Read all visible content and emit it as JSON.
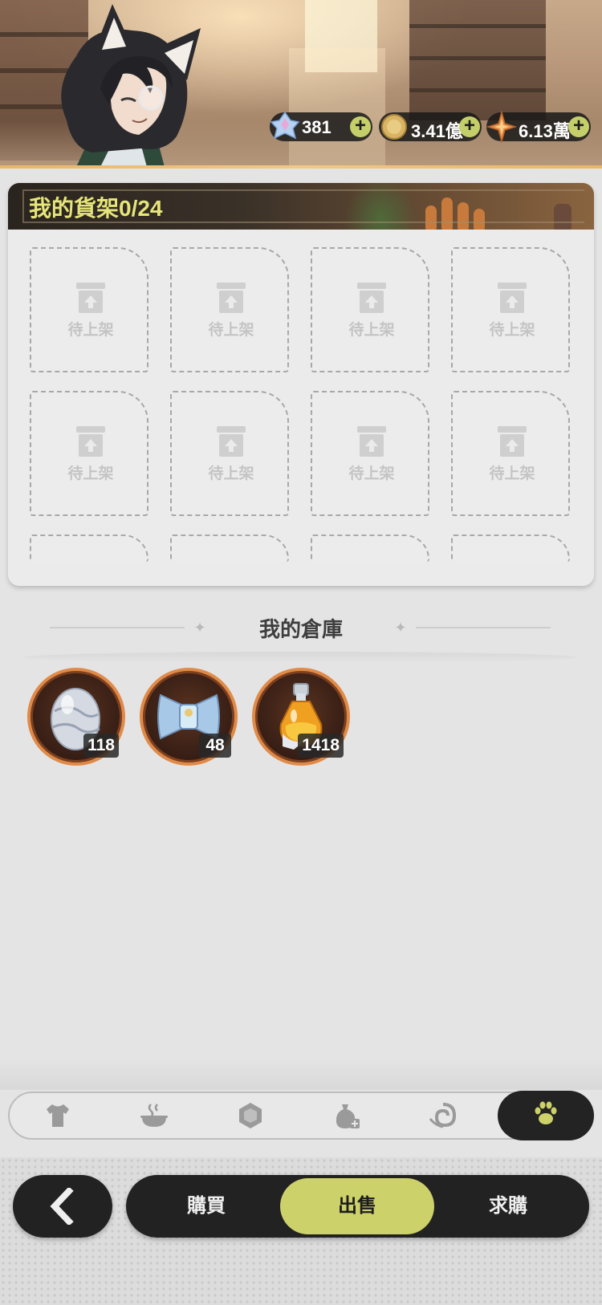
{
  "header": {
    "currencies": [
      {
        "name": "crystal",
        "icon": "crystal-gem-icon",
        "value": "381"
      },
      {
        "name": "gold-coin",
        "icon": "gold-coin-icon",
        "value": "3.41億"
      },
      {
        "name": "star-shard",
        "icon": "star-shard-icon",
        "value": "6.13萬"
      }
    ],
    "plus_label": "+"
  },
  "shelf": {
    "title": "我的貨架0/24",
    "slot_label": "待上架",
    "slots": [
      "待上架",
      "待上架",
      "待上架",
      "待上架",
      "待上架",
      "待上架",
      "待上架",
      "待上架"
    ]
  },
  "warehouse": {
    "title": "我的倉庫",
    "items": [
      {
        "name": "egg",
        "icon": "egg-icon",
        "qty": "118"
      },
      {
        "name": "bandage-scroll",
        "icon": "bandage-icon",
        "qty": "48"
      },
      {
        "name": "potion",
        "icon": "potion-icon",
        "qty": "1418"
      }
    ]
  },
  "categories": [
    {
      "name": "clothing",
      "icon": "shirt-icon",
      "active": false
    },
    {
      "name": "food",
      "icon": "bowl-icon",
      "active": false
    },
    {
      "name": "gem",
      "icon": "hexagon-gem-icon",
      "active": false
    },
    {
      "name": "materials",
      "icon": "sack-icon",
      "active": false
    },
    {
      "name": "misc",
      "icon": "swirl-icon",
      "active": false
    },
    {
      "name": "pets",
      "icon": "paw-icon",
      "active": true
    }
  ],
  "colors": {
    "accent": "#ccd16a",
    "dark": "#222222",
    "item_ring": "#e08a48",
    "shelf_title": "#e6e57a"
  },
  "nav": {
    "back_icon": "chevron-left-icon",
    "modes": [
      {
        "label": "購買",
        "active": false
      },
      {
        "label": "出售",
        "active": true
      },
      {
        "label": "求購",
        "active": false
      }
    ]
  }
}
